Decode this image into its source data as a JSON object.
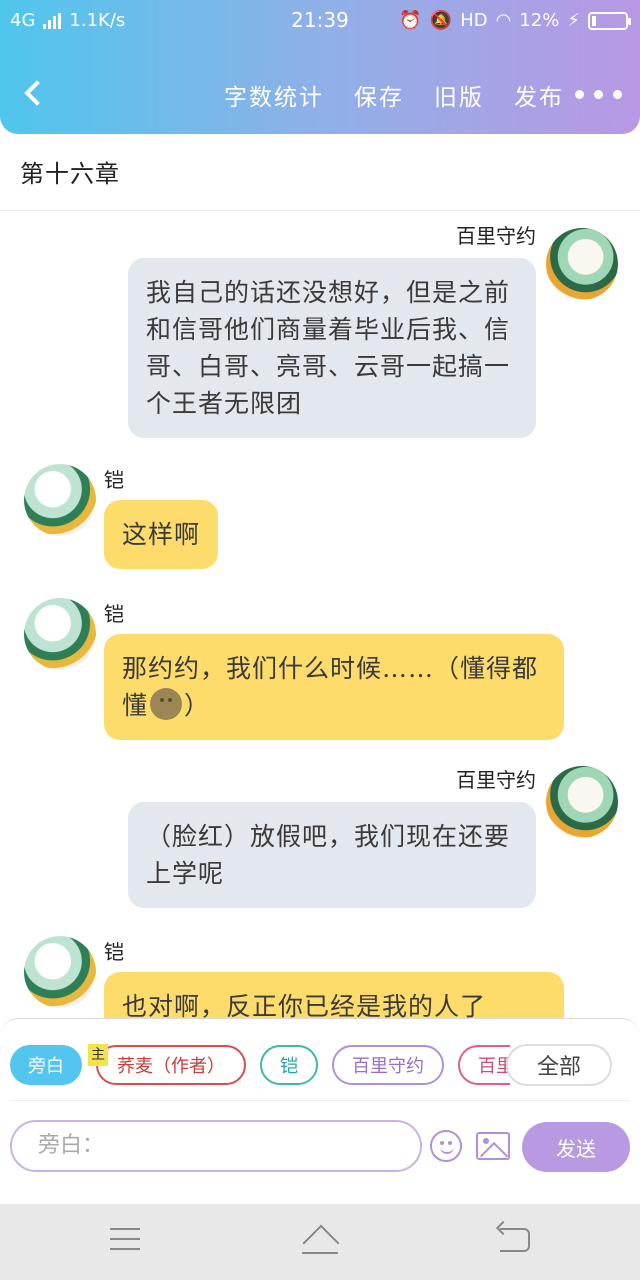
{
  "status_bar": {
    "network": "4G",
    "speed": "1.1K/s",
    "time": "21:39",
    "hd": "HD",
    "battery": "12%",
    "battery_level": 0.12
  },
  "header": {
    "back_icon": "chevron-left-icon",
    "actions": [
      "字数统计",
      "保存",
      "旧版",
      "发布"
    ],
    "more_icon": "more-dots-icon"
  },
  "chapter": {
    "title": "第十六章"
  },
  "messages": [
    {
      "side": "right",
      "name": "百里守约",
      "text": "我自己的话还没想好，但是之前和信哥他们商量着毕业后我、信哥、白哥、亮哥、云哥一起搞一个王者无限团"
    },
    {
      "side": "left",
      "name": "铠",
      "text": "这样啊"
    },
    {
      "side": "left",
      "name": "铠",
      "text_before": "那约约，我们什么时候……（懂得都懂",
      "emoji": "smile-emoji",
      "text_after": "）"
    },
    {
      "side": "right",
      "name": "百里守约",
      "text": "（脸红）放假吧，我们现在还要上学呢"
    },
    {
      "side": "left",
      "name": "铠",
      "text": "也对啊，反正你已经是我的人了"
    }
  ],
  "roles": {
    "items": [
      "旁白",
      "荞麦（作者）",
      "铠",
      "百里守约",
      "百里"
    ],
    "main_tag": "主",
    "all_label": "全部"
  },
  "composer": {
    "placeholder": "旁白：",
    "emoji_icon": "smiley-icon",
    "image_icon": "image-icon",
    "send_label": "发送"
  },
  "system_nav": [
    "menu-icon",
    "home-icon",
    "back-icon"
  ],
  "colors": {
    "header_start": "#4fc6ec",
    "header_end": "#b898e4",
    "bubble_right": "#e3e7ee",
    "bubble_left": "#fedc6c",
    "send_button": "#b89ae2"
  }
}
